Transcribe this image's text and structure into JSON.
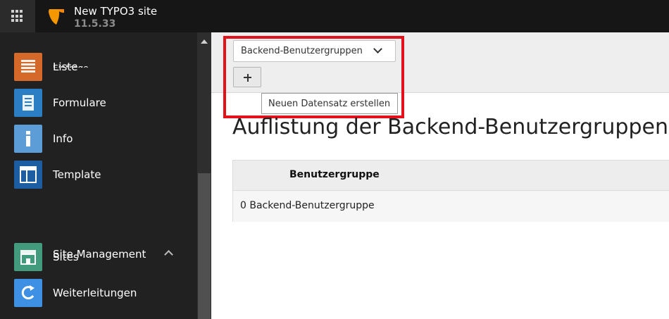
{
  "topbar": {
    "site_name": "New TYPO3 site",
    "version": "11.5.33"
  },
  "sidebar": {
    "partial_item_label": "Einträge",
    "items": [
      {
        "label": "Liste",
        "icon": "list-icon",
        "color": "#d5692a"
      },
      {
        "label": "Formulare",
        "icon": "form-icon",
        "color": "#2c7ec4"
      },
      {
        "label": "Info",
        "icon": "info-icon",
        "color": "#5c9dd8"
      },
      {
        "label": "Template",
        "icon": "template-icon",
        "color": "#1d5ea3"
      }
    ],
    "group": {
      "label": "Site Management",
      "icon": "globe-icon"
    },
    "group_items": [
      {
        "label": "Sites",
        "icon": "sites-icon",
        "color": "#439b7e"
      },
      {
        "label": "Weiterleitungen",
        "icon": "redirect-icon",
        "color": "#3d90e3"
      }
    ]
  },
  "docheader": {
    "select_value": "Backend-Benutzergruppen",
    "add_button_icon": "plus-icon",
    "tooltip": "Neuen Datensatz erstellen",
    "highlight_color": "#e2111c"
  },
  "main": {
    "title": "Auflistung der Backend-Benutzergruppen",
    "table": {
      "header": "Benutzergruppe",
      "row": "0 Backend-Benutzergruppe"
    }
  }
}
